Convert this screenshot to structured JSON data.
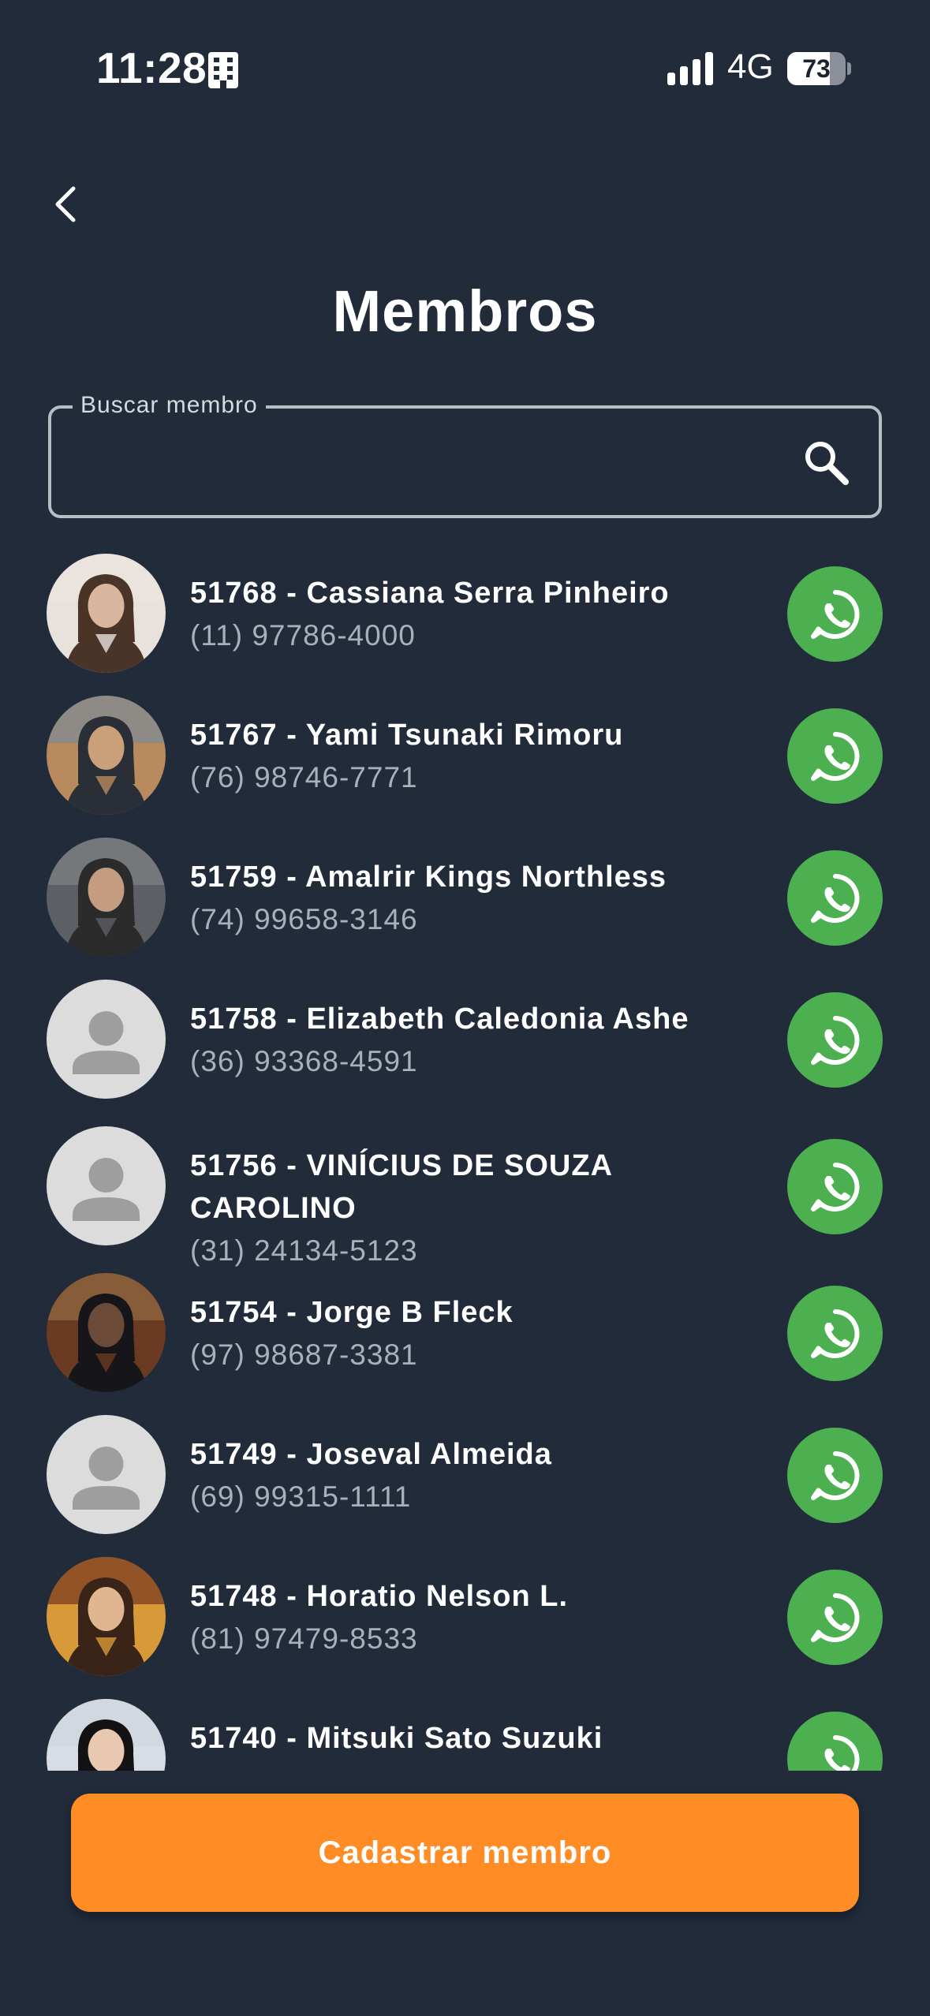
{
  "status_bar": {
    "time": "11:28",
    "network": "4G",
    "battery": "73",
    "battery_level": 0.73
  },
  "header": {
    "title": "Membros",
    "back_icon": "chevron-left-icon"
  },
  "search": {
    "label": "Buscar membro",
    "value": "",
    "icon": "search-icon"
  },
  "colors": {
    "background": "#212b3a",
    "whatsapp": "#4caf50",
    "accent": "#ff8c25"
  },
  "members": [
    {
      "name": "51768 - Cassiana Serra Pinheiro",
      "phone": "(11) 97786-4000",
      "avatar": "photo"
    },
    {
      "name": "51767 - Yami Tsunaki Rimoru",
      "phone": "(76) 98746-7771",
      "avatar": "photo"
    },
    {
      "name": "51759 - Amalrir Kings Northless",
      "phone": "(74) 99658-3146",
      "avatar": "photo"
    },
    {
      "name": "51758 - Elizabeth Caledonia Ashe",
      "phone": "(36) 93368-4591",
      "avatar": "placeholder"
    },
    {
      "name": "51756 - VINÍCIUS DE SOUZA CAROLINO",
      "phone": "(31) 24134-5123",
      "avatar": "placeholder"
    },
    {
      "name": "51754 - Jorge B Fleck",
      "phone": "(97) 98687-3381",
      "avatar": "photo"
    },
    {
      "name": "51749 - Joseval Almeida",
      "phone": "(69) 99315-1111",
      "avatar": "placeholder"
    },
    {
      "name": "51748 - Horatio Nelson L.",
      "phone": "(81) 97479-8533",
      "avatar": "photo"
    },
    {
      "name": "51740 - Mitsuki Sato Suzuki",
      "phone": "",
      "avatar": "photo"
    }
  ],
  "actions": {
    "register_label": "Cadastrar membro"
  }
}
